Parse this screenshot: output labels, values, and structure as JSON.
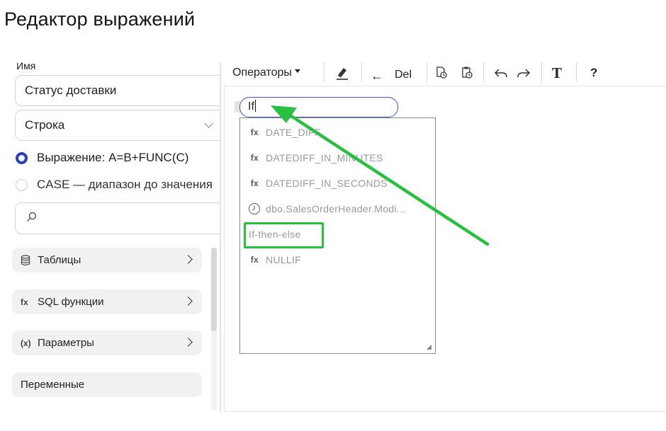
{
  "page": {
    "title": "Редактор выражений"
  },
  "left": {
    "name_label": "Имя",
    "name_value": "Статус доставки",
    "type_value": "Строка",
    "radio_expression": "Выражение: A=B+FUNC(C)",
    "radio_case": "CASE — диапазон до значения",
    "search_placeholder": "",
    "accordions": [
      {
        "icon": "database-icon",
        "label": "Таблицы"
      },
      {
        "icon": "fx-icon",
        "icon_text": "fx",
        "label": "SQL функции"
      },
      {
        "icon": "parameters-icon",
        "icon_text": "(x)",
        "label": "Параметры"
      },
      {
        "label": "Переменные"
      }
    ]
  },
  "toolbar": {
    "operators_label": "Операторы",
    "back_arrow": "←",
    "del_label": "Del",
    "text_label": "T",
    "help_label": "?"
  },
  "editor": {
    "input_value": "If"
  },
  "suggestions": [
    {
      "icon": "fx",
      "label": "DATE_DIFF"
    },
    {
      "icon": "fx",
      "label": "DATEDIFF_IN_MINUTES"
    },
    {
      "icon": "fx",
      "label": "DATEDIFF_IN_SECONDS"
    },
    {
      "icon": "clock",
      "label": "dbo.SalesOrderHeader.Modi..."
    },
    {
      "icon": "none",
      "label": "If-then-else"
    },
    {
      "icon": "fx",
      "label": "NULLIF"
    }
  ],
  "colors": {
    "accent_blue": "#3a55d6",
    "annotation_green": "#27c040"
  }
}
